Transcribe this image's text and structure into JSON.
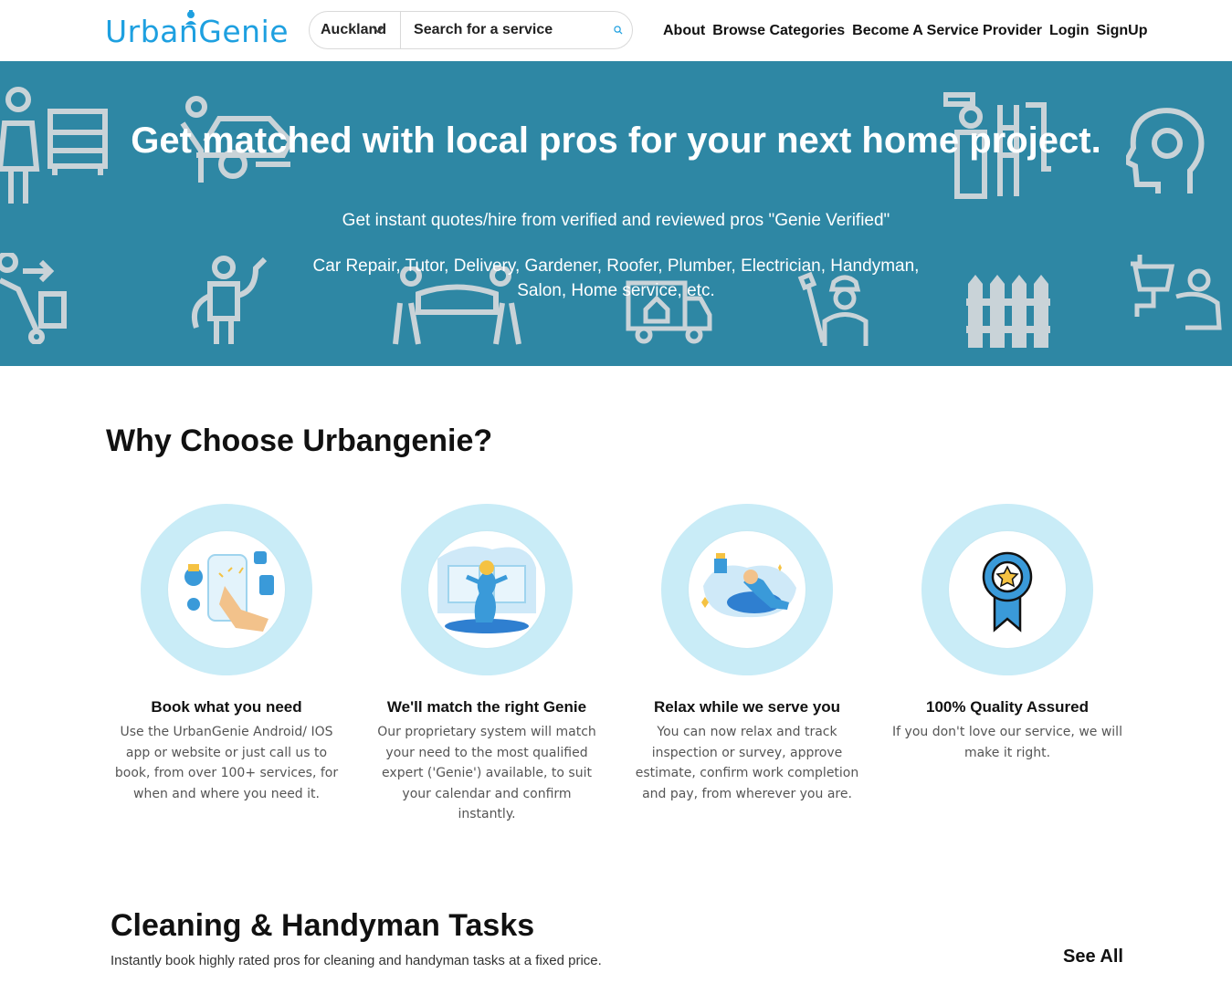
{
  "header": {
    "logo": "UrbanGenie",
    "city": "Auckland",
    "search_placeholder": "Search for a service",
    "nav": [
      "About",
      "Browse Categories",
      "Become A Service Provider",
      "Login",
      "SignUp"
    ]
  },
  "hero": {
    "title": "Get matched with local pros for your next home project.",
    "subtitle": "Get instant quotes/hire from verified and reviewed pros \"Genie Verified\"",
    "categories": "Car Repair, Tutor, Delivery, Gardener, Roofer, Plumber, Electrician, Handyman, Salon, Home service, etc.",
    "background_color": "#2e87a4"
  },
  "why": {
    "title": "Why Choose Urbangenie?",
    "features": [
      {
        "icon": "booking-phone-icon",
        "title": "Book what you need",
        "text": "Use the UrbanGenie Android/ IOS app or website or just call us to book, from over 100+ services, for when and where you need it."
      },
      {
        "icon": "genie-match-icon",
        "title": "We'll match the right Genie",
        "text": "Our proprietary system will match your need to the most qualified expert ('Genie') available, to suit your calendar and confirm instantly."
      },
      {
        "icon": "relax-icon",
        "title": "Relax while we serve you",
        "text": "You can now relax and track inspection or survey, approve estimate, confirm work completion and pay, from wherever you are."
      },
      {
        "icon": "quality-badge-icon",
        "title": "100%  Quality Assured",
        "text": "If you don't love our service, we will make it right."
      }
    ]
  },
  "cleaning": {
    "title": "Cleaning & Handyman Tasks",
    "subtitle": "Instantly book highly rated pros for cleaning and handyman tasks at a fixed price.",
    "see_all": "See All"
  },
  "colors": {
    "brand": "#1ea0e0",
    "hero": "#2e87a4",
    "ring": "#c9ecf7"
  }
}
